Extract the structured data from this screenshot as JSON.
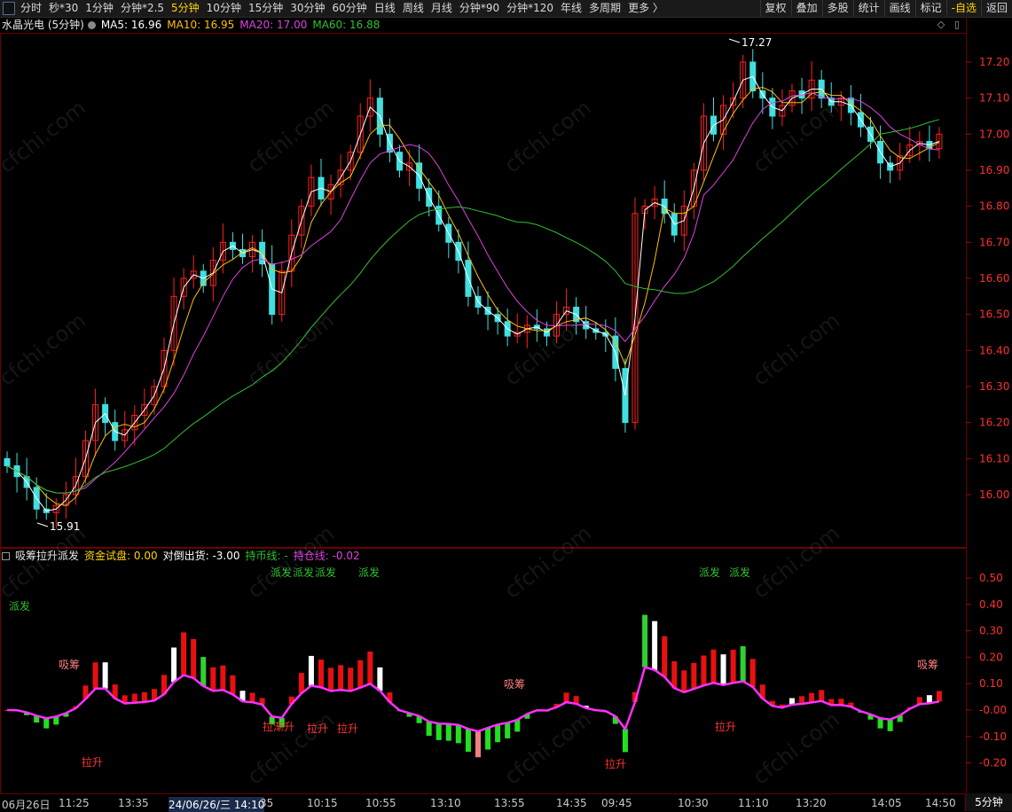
{
  "toolbar": {
    "tabs": [
      "分时",
      "秒*30",
      "1分钟",
      "分钟*2.5",
      "5分钟",
      "10分钟",
      "15分钟",
      "30分钟",
      "60分钟",
      "日线",
      "周线",
      "月线",
      "分钟*90",
      "分钟*120",
      "年线",
      "多周期",
      "更多 〉"
    ],
    "active_tab": "5分钟",
    "right_buttons": [
      "复权",
      "叠加",
      "多股",
      "统计",
      "画线",
      "标记",
      "-自选",
      "返回"
    ]
  },
  "main": {
    "stock_title": "水晶光电 (5分钟)",
    "ma_legend": [
      {
        "label": "MA5: 16.96",
        "color": "#ffffff"
      },
      {
        "label": "MA10: 16.95",
        "color": "#ffc000"
      },
      {
        "label": "MA20: 17.00",
        "color": "#e040e0"
      },
      {
        "label": "MA60: 16.88",
        "color": "#30c030"
      }
    ],
    "high_label": "17.27",
    "low_label": "15.91",
    "price_axis": [
      "17.20",
      "17.10",
      "17.00",
      "16.90",
      "16.80",
      "16.70",
      "16.60",
      "16.50",
      "16.40",
      "16.30",
      "16.20",
      "16.10",
      "16.00"
    ]
  },
  "indicator": {
    "name": "吸筹拉升派发",
    "items": [
      {
        "label": "资金试盘: 0.00",
        "color": "#ffd400"
      },
      {
        "label": "对倒出货: -3.00",
        "color": "#ffffff"
      },
      {
        "label": "持币线: -",
        "color": "#30c030"
      },
      {
        "label": "持仓线: -0.02",
        "color": "#e040e0"
      }
    ],
    "axis": [
      "0.50",
      "0.40",
      "0.30",
      "0.20",
      "0.10",
      "-0.00",
      "-0.10",
      "-0.20"
    ],
    "annotations": [
      {
        "text": "派发",
        "color": "#30c030"
      },
      {
        "text": "吸筹",
        "color": "#ff8080"
      },
      {
        "text": "拉升",
        "color": "#ff3030"
      }
    ],
    "label_texts": {
      "paifa": "派发",
      "xichou": "吸筹",
      "lasheng": "拉升",
      "lachou": "拉渐升"
    }
  },
  "time_axis": {
    "labels": [
      "06月26日",
      "11:25",
      "13:35",
      "24/06/26/三 14:10",
      "35",
      "10:15",
      "10:55",
      "13:10",
      "13:55",
      "14:35",
      "09:45",
      "10:30",
      "11:10",
      "13:20",
      "14:05",
      "14:50"
    ],
    "period_tag": "5分钟"
  },
  "watermark": "cfchi.com",
  "colors": {
    "up": "#ff2020",
    "down": "#40e0e0",
    "panel_border": "#6b0000"
  },
  "chart_data": {
    "type": "candlestick",
    "series_close": [
      16.08,
      16.05,
      16.02,
      15.96,
      15.95,
      15.97,
      16.0,
      16.05,
      16.15,
      16.25,
      16.2,
      16.15,
      16.18,
      16.22,
      16.25,
      16.3,
      16.4,
      16.55,
      16.6,
      16.62,
      16.58,
      16.65,
      16.7,
      16.68,
      16.66,
      16.7,
      16.64,
      16.5,
      16.62,
      16.72,
      16.8,
      16.88,
      16.82,
      16.86,
      16.9,
      16.95,
      17.05,
      17.1,
      17.0,
      16.95,
      16.9,
      16.92,
      16.85,
      16.8,
      16.75,
      16.7,
      16.65,
      16.55,
      16.52,
      16.5,
      16.48,
      16.44,
      16.45,
      16.47,
      16.46,
      16.44,
      16.5,
      16.52,
      16.48,
      16.46,
      16.45,
      16.44,
      16.35,
      16.2,
      16.78,
      16.8,
      16.82,
      16.78,
      16.72,
      16.8,
      16.9,
      17.05,
      17.0,
      17.08,
      17.1,
      17.2,
      17.12,
      17.1,
      17.05,
      17.08,
      17.12,
      17.1,
      17.15,
      17.1,
      17.08,
      17.1,
      17.06,
      17.02,
      16.98,
      16.92,
      16.9,
      16.94,
      16.97,
      16.98,
      16.96,
      17.0
    ],
    "y_range": [
      15.91,
      17.27
    ]
  }
}
